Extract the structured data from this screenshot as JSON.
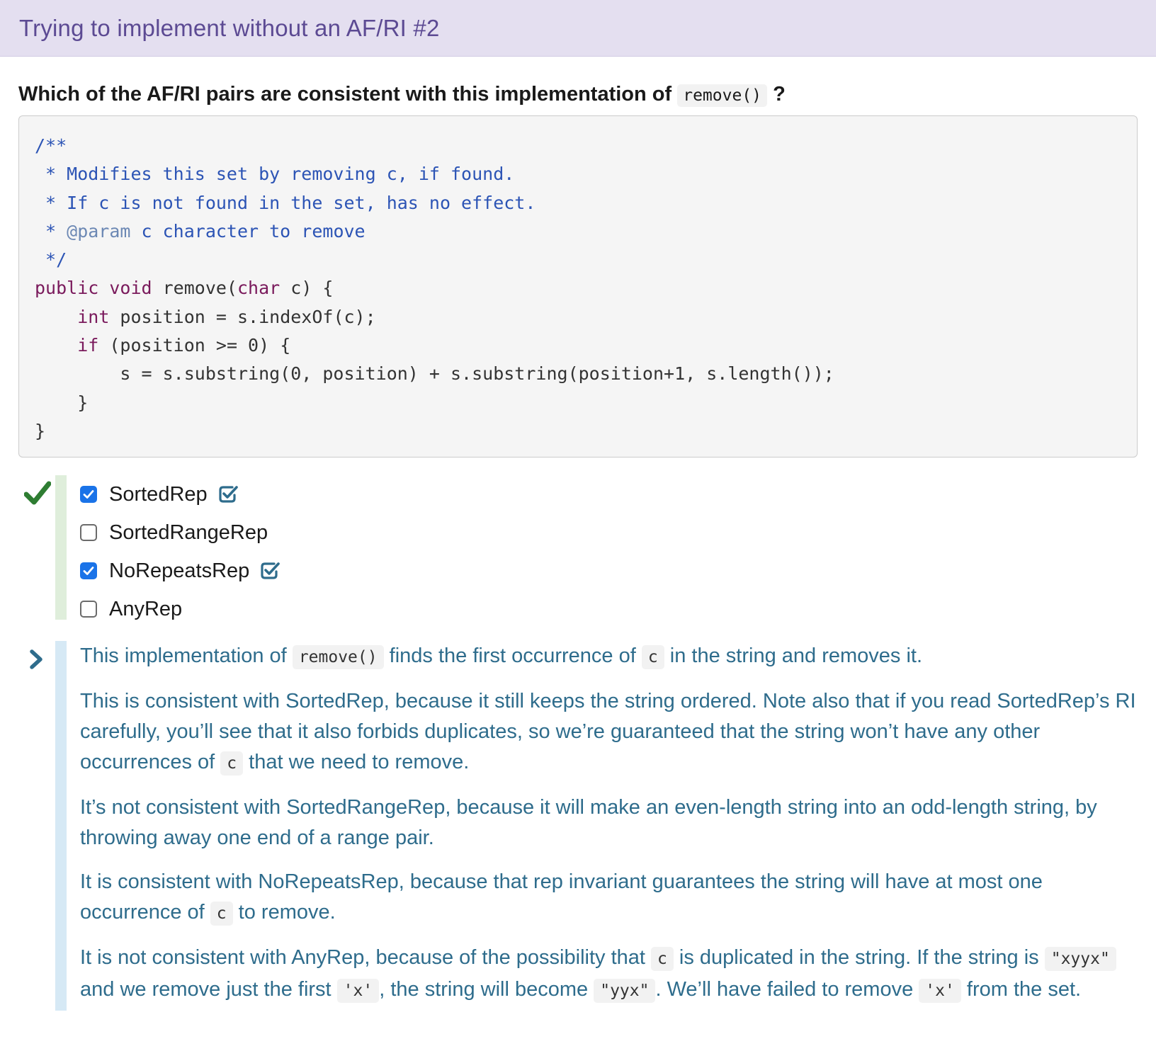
{
  "header": {
    "title": "Trying to implement without an AF/RI #2"
  },
  "question": {
    "before": "Which of the AF/RI pairs are consistent with this implementation of ",
    "code": "remove()",
    "after": " ?"
  },
  "code": {
    "l1": "/**",
    "l2": " * Modifies this set by removing c, if found.",
    "l3": " * If c is not found in the set, has no effect.",
    "l4a": " * ",
    "l4tag": "@param",
    "l4b": " c character to remove",
    "l5": " */",
    "l6kw": "public void",
    "l6a": " remove(",
    "l6kw2": "char",
    "l6b": " c) {",
    "l7a": "    ",
    "l7kw": "int",
    "l7b": " position = s.indexOf(c);",
    "l8a": "    ",
    "l8kw": "if",
    "l8b": " (position >= 0) {",
    "l9": "        s = s.substring(0, position) + s.substring(position+1, s.length());",
    "l10": "    }",
    "l11": "}"
  },
  "options": [
    {
      "label": "SortedRep",
      "checked": true,
      "verified": true
    },
    {
      "label": "SortedRangeRep",
      "checked": false,
      "verified": false
    },
    {
      "label": "NoRepeatsRep",
      "checked": true,
      "verified": true
    },
    {
      "label": "AnyRep",
      "checked": false,
      "verified": false
    }
  ],
  "explanation": {
    "p1": {
      "t1": "This implementation of ",
      "c1": "remove()",
      "t2": " finds the first occurrence of ",
      "c2": "c",
      "t3": " in the string and removes it."
    },
    "p2": {
      "t1": "This is consistent with SortedRep, because it still keeps the string ordered. Note also that if you read SortedRep’s RI carefully, you’ll see that it also forbids duplicates, so we’re guaranteed that the string won’t have any other occurrences of ",
      "c1": "c",
      "t2": " that we need to remove."
    },
    "p3": {
      "t1": "It’s not consistent with SortedRangeRep, because it will make an even-length string into an odd-length string, by throwing away one end of a range pair."
    },
    "p4": {
      "t1": "It is consistent with NoRepeatsRep, because that rep invariant guarantees the string will have at most one occurrence of ",
      "c1": "c",
      "t2": " to remove."
    },
    "p5": {
      "t1": "It is not consistent with AnyRep, because of the possibility that ",
      "c1": "c",
      "t2": " is duplicated in the string. If the string is ",
      "c2": "\"xyyx\"",
      "t3": " and we remove just the first ",
      "c3": "'x'",
      "t4": ", the string will become ",
      "c4": "\"yyx\"",
      "t5": ". We’ll have failed to remove ",
      "c5": "'x'",
      "t6": " from the set."
    }
  },
  "colors": {
    "header_bg": "#e4dff0",
    "header_text": "#5c4a93",
    "correct_green": "#2e7d32",
    "answer_bar": "#dfeedb",
    "explain_bar": "#d6e9f5",
    "explain_text": "#2e6c8c",
    "checkbox_blue": "#1a73e8"
  },
  "icons": {
    "result": "checkmark-icon",
    "verified": "check-square-icon",
    "toggle": "chevron-right-icon"
  }
}
